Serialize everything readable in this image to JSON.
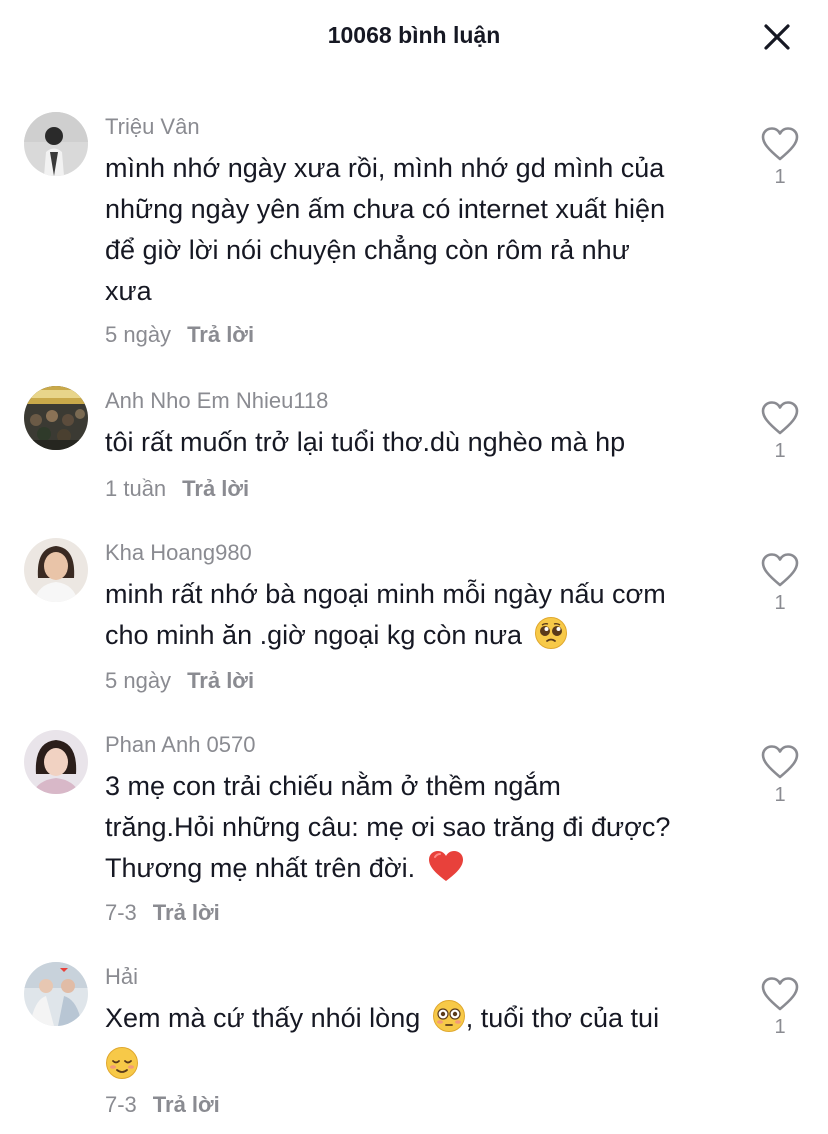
{
  "header": {
    "title": "10068 bình luận",
    "close_icon": "close-icon"
  },
  "comments": [
    {
      "username": "Triệu Vân",
      "lines": [
        "mình nhớ ngày xưa rồi, mình nhớ gd mình của",
        "những ngày yên ấm chưa có internet xuất hiện",
        "để giờ lời nói chuyện chẳng còn rôm rả như",
        "xưa"
      ],
      "time": "5 ngày",
      "reply": "Trả lời",
      "likes": "1"
    },
    {
      "username": "Anh Nho Em Nhieu118",
      "lines": [
        "tôi rất muốn trở lại tuổi thơ.dù nghèo mà hp"
      ],
      "time": "1 tuần",
      "reply": "Trả lời",
      "likes": "1"
    },
    {
      "username": "Kha Hoang980",
      "lines": [
        "minh rất nhớ bà ngoại minh mỗi ngày nấu cơm",
        "cho minh ăn .giờ ngoại kg còn nưa"
      ],
      "emoji": "pleading-face",
      "time": "5 ngày",
      "reply": "Trả lời",
      "likes": "1"
    },
    {
      "username": "Phan Anh 0570",
      "lines": [
        "3 mẹ con trải chiếu nằm ở thềm ngắm",
        "trăng.Hỏi những câu: mẹ ơi sao trăng đi được?",
        "Thương mẹ nhất trên đời."
      ],
      "emoji": "red-heart",
      "time": "7-3",
      "reply": "Trả lời",
      "likes": "1"
    },
    {
      "username": "Hải",
      "lines": [
        "Xem mà cứ thấy nhói lòng",
        ", tuổi thơ của tui"
      ],
      "emoji": "flushed-face, relieved-face",
      "time": "7-3",
      "reply": "Trả lời",
      "likes": "1"
    }
  ],
  "colors": {
    "text": "#161823",
    "secondary": "#8a8b91",
    "background": "#ffffff"
  }
}
